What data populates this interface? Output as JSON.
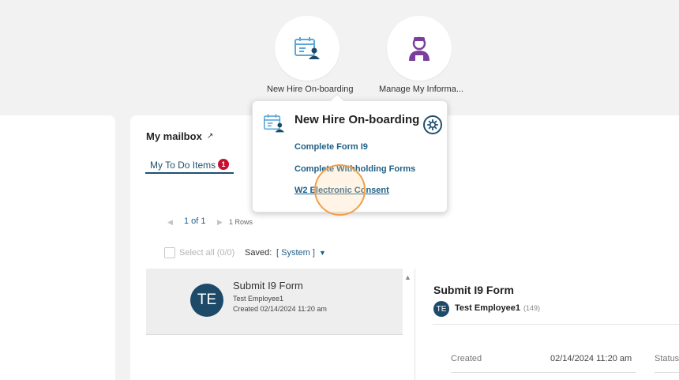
{
  "top_tiles": [
    {
      "label": "New Hire On-boarding",
      "icon": "calendar-person-icon"
    },
    {
      "label": "Manage My Informa...",
      "icon": "person-avatar-icon"
    }
  ],
  "mailbox": {
    "title": "My mailbox",
    "external_icon": "↗",
    "tab_label": "My To Do Items",
    "tab_badge": "1",
    "pager": {
      "page": "1 of 1",
      "rows": "1 Rows"
    },
    "select_all_label": "Select all (0/0)",
    "saved_label": "Saved:",
    "saved_value": "[ System ]"
  },
  "list": [
    {
      "initials": "TE",
      "title": "Submit I9 Form",
      "person": "Test Employee1",
      "created": "Created 02/14/2024 11:20 am"
    }
  ],
  "detail": {
    "title": "Submit I9 Form",
    "initials": "TE",
    "person": "Test Employee1",
    "count": "(149)",
    "created_label": "Created",
    "created_value": "02/14/2024 11:20 am",
    "status_label": "Status"
  },
  "popup": {
    "title": "New Hire On-boarding",
    "links": [
      "Complete Form I9",
      "Complete Withholding Forms",
      "W2 Electronic Consent"
    ]
  },
  "colors": {
    "brand_navy": "#1d4a68",
    "link_blue": "#1f5f86",
    "badge_red": "#c8102e",
    "accent_purple": "#7a3f9d",
    "icon_blue": "#5aa7d8"
  }
}
